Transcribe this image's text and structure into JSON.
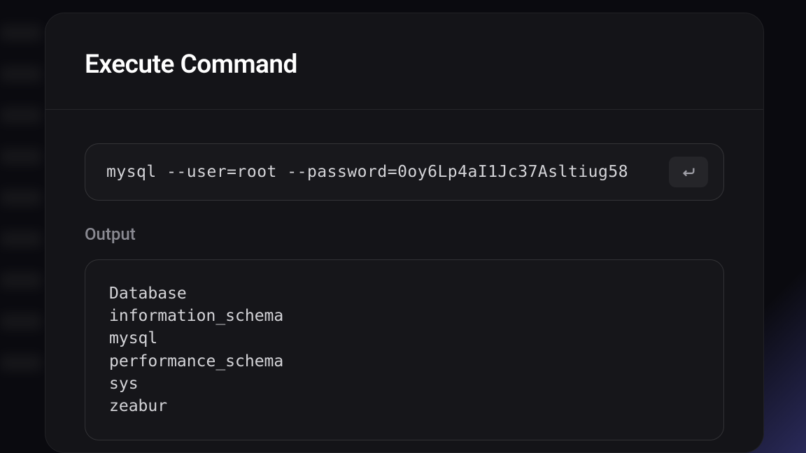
{
  "modal": {
    "title": "Execute Command"
  },
  "command": {
    "value": "mysql --user=root --password=0oy6Lp4aI1Jc37Asltiug58"
  },
  "output": {
    "label": "Output",
    "lines": [
      "Database",
      "information_schema",
      "mysql",
      "performance_schema",
      "sys",
      "zeabur"
    ]
  }
}
